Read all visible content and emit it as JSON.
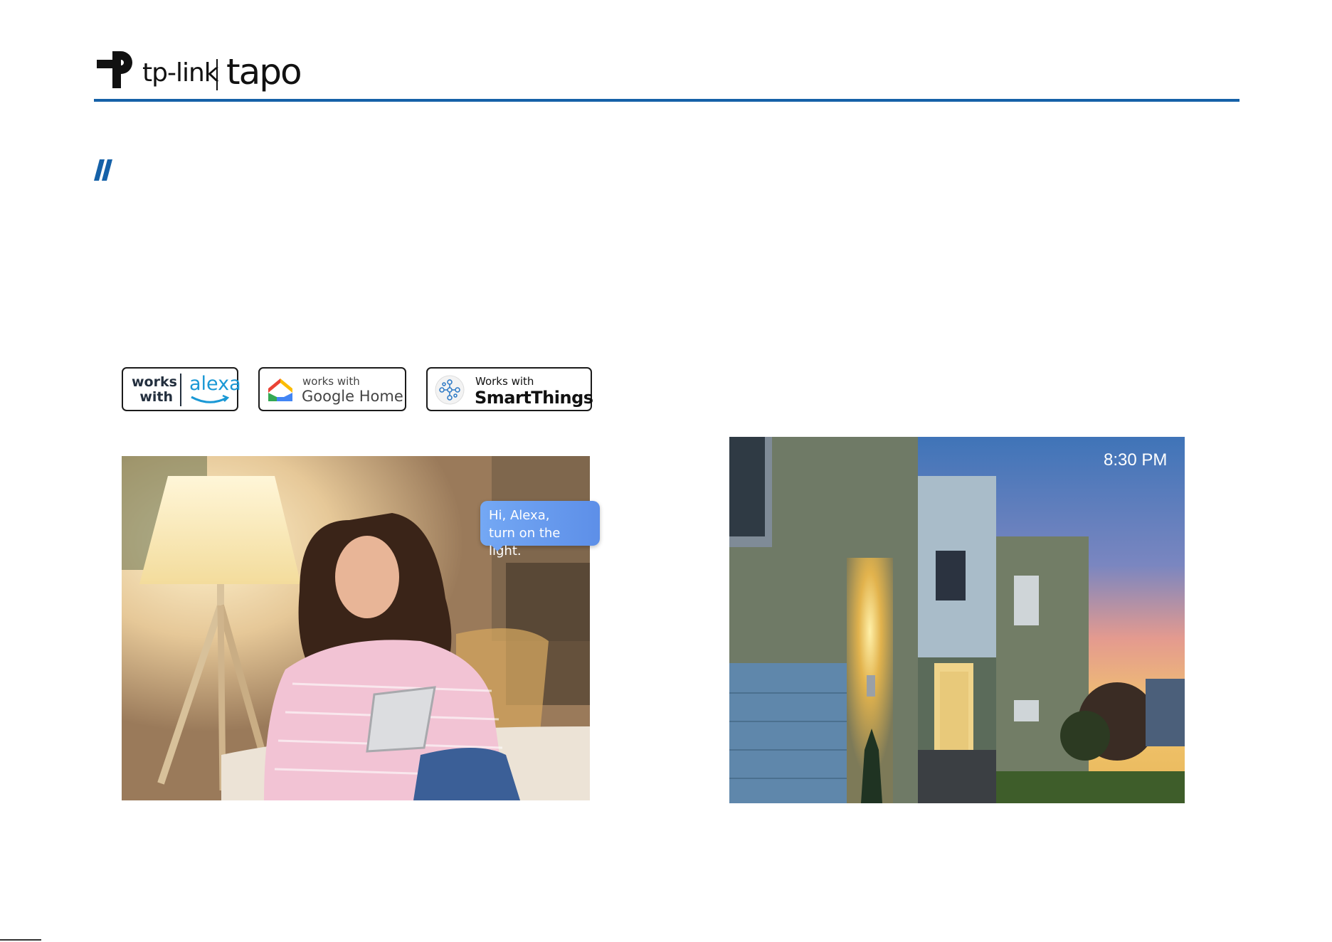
{
  "header": {
    "brand_primary": "tp-link",
    "brand_secondary": "tapo",
    "accent_color": "#1561a8"
  },
  "badges": {
    "alexa": {
      "works_line1": "works",
      "works_line2": "with",
      "name": "alexa"
    },
    "google": {
      "works": "works with",
      "name": "Google Home"
    },
    "smartthings": {
      "works": "Works with",
      "name": "SmartThings"
    }
  },
  "living_room_photo": {
    "bubble_line1": "Hi, Alexa,",
    "bubble_line2": "turn on the light."
  },
  "house_photo": {
    "time": "8:30 PM"
  },
  "icons": [
    "tp-link-logo-icon",
    "section-marker-icon",
    "google-home-icon",
    "smartthings-icon",
    "alexa-smile-icon"
  ]
}
